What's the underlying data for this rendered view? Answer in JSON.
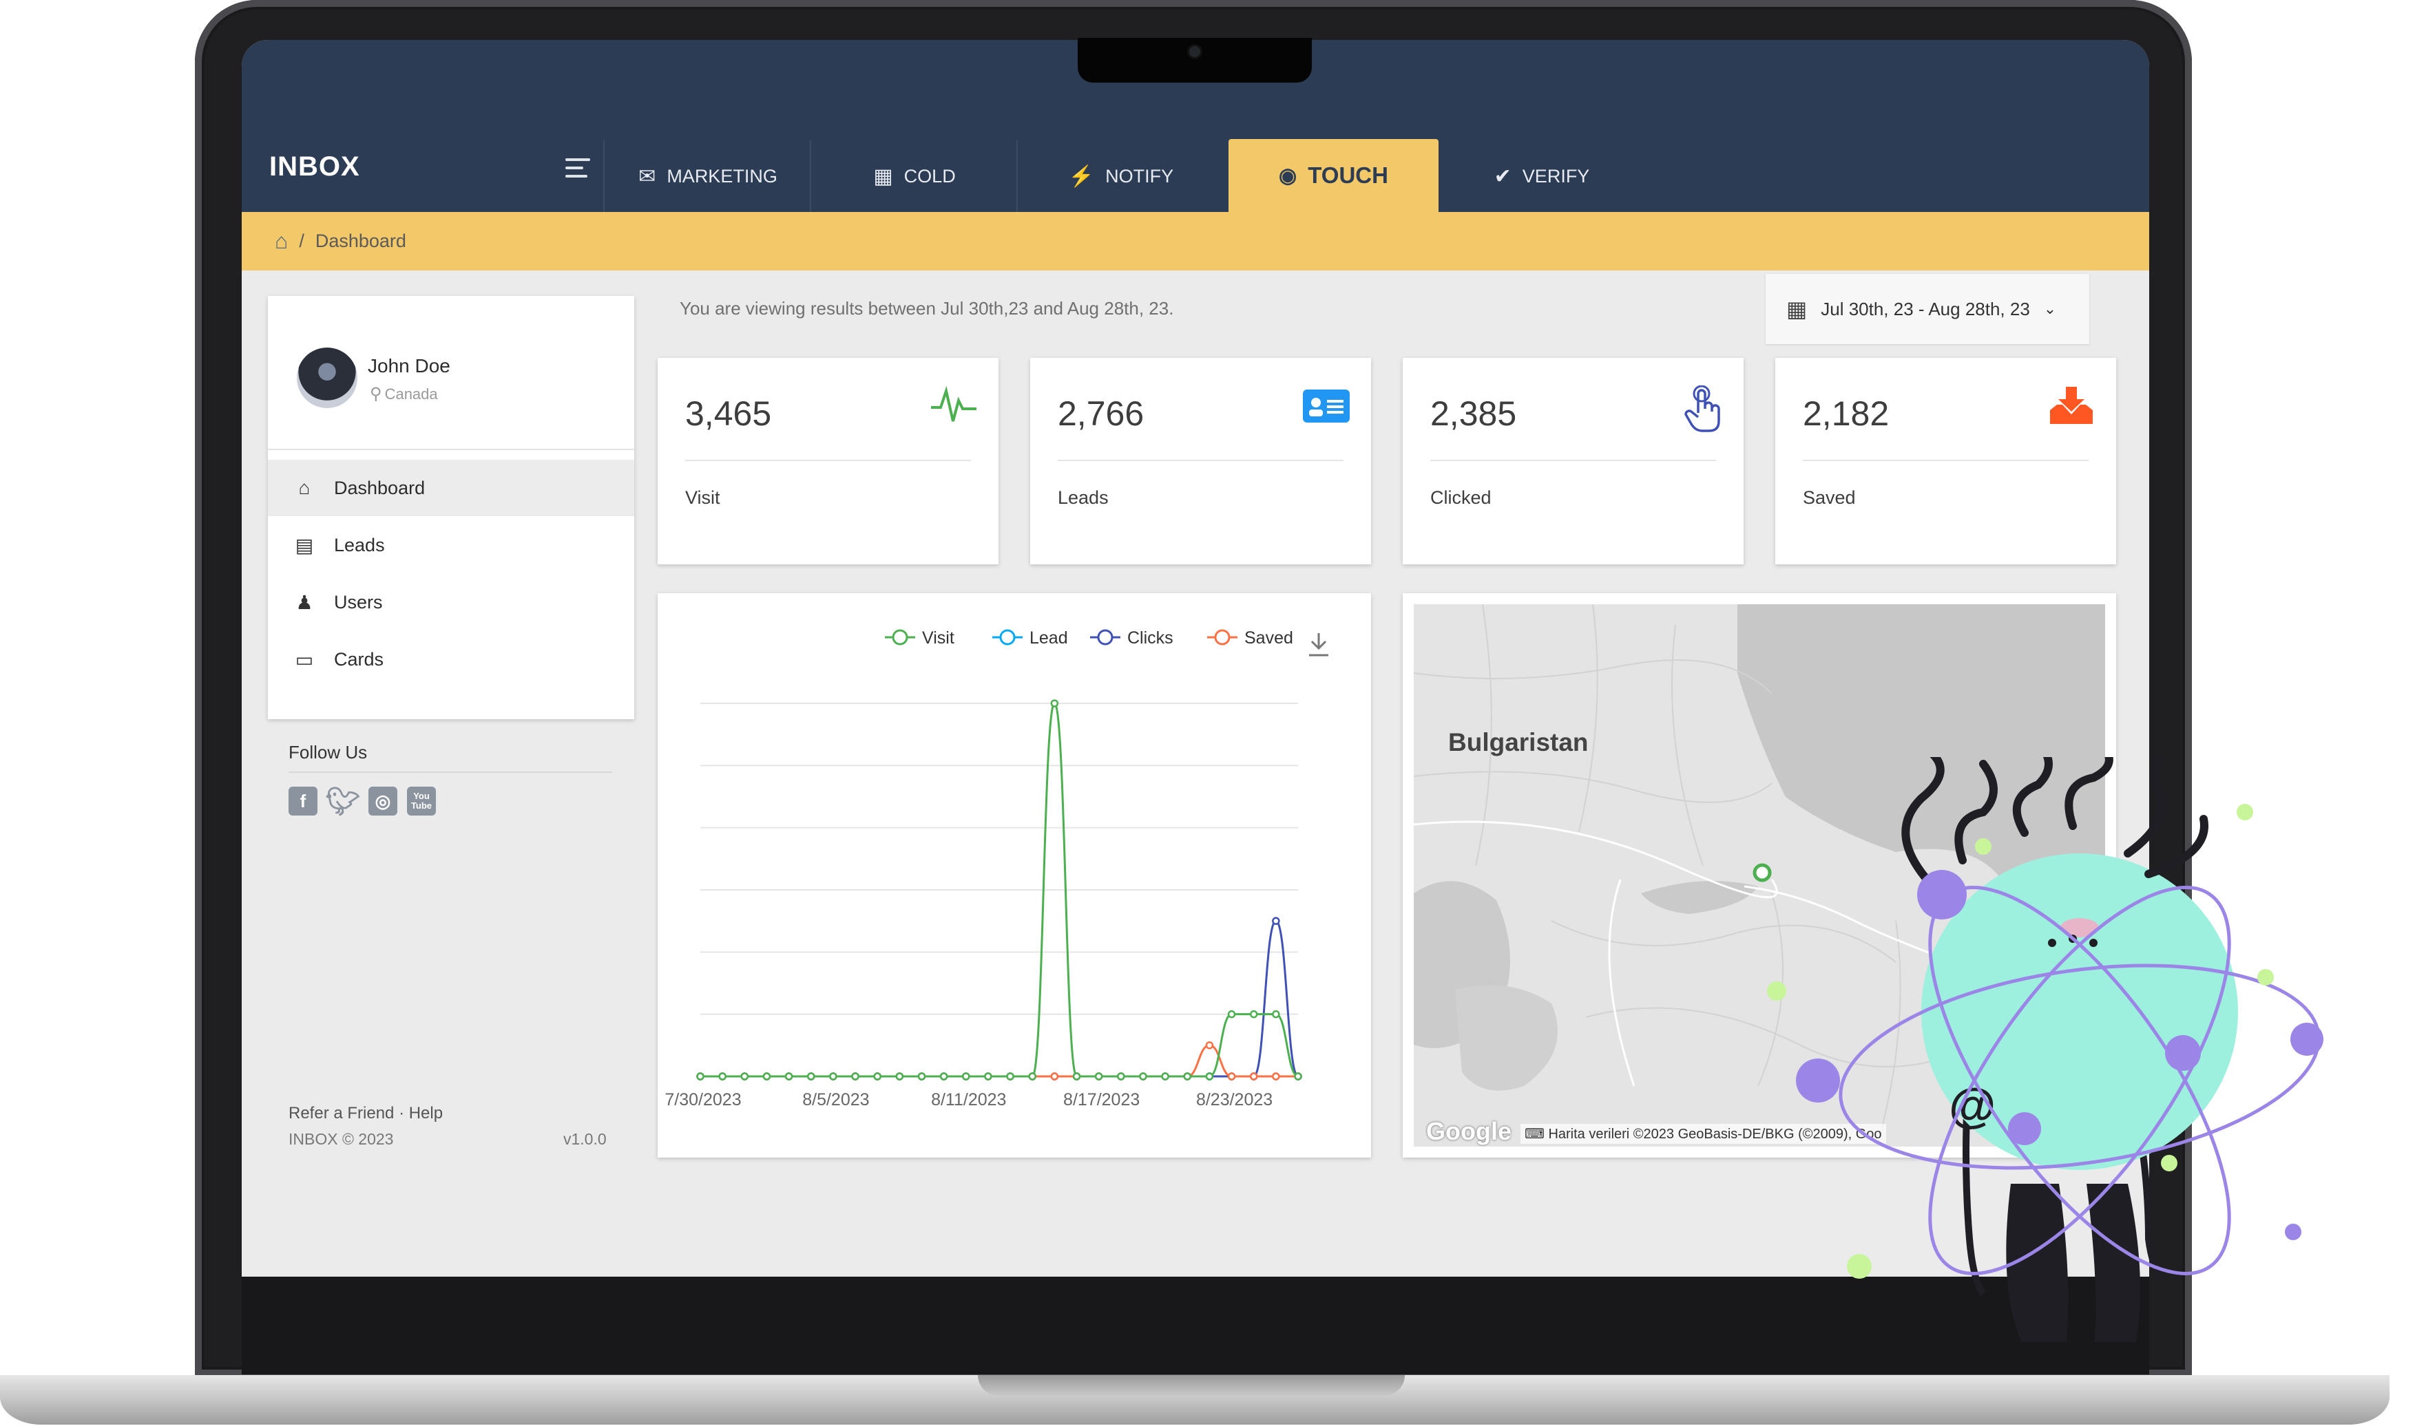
{
  "app": {
    "logo": "INBOX"
  },
  "nav": {
    "tabs": [
      {
        "label": "MARKETING",
        "icon": "envelope-icon"
      },
      {
        "label": "COLD",
        "icon": "calendar-grid-icon"
      },
      {
        "label": "NOTIFY",
        "icon": "lightning-icon"
      },
      {
        "label": "TOUCH",
        "icon": "fingerprint-icon",
        "active": true
      },
      {
        "label": "VERIFY",
        "icon": "checkmark-icon"
      }
    ]
  },
  "breadcrumb": {
    "current": "Dashboard"
  },
  "profile": {
    "name": "John Doe",
    "location": "Canada"
  },
  "sidebar": {
    "items": [
      {
        "label": "Dashboard",
        "icon": "home-icon",
        "active": true
      },
      {
        "label": "Leads",
        "icon": "id-card-icon"
      },
      {
        "label": "Users",
        "icon": "user-icon"
      },
      {
        "label": "Cards",
        "icon": "credit-card-icon"
      }
    ],
    "follow_title": "Follow Us",
    "social": [
      "facebook-icon",
      "twitter-icon",
      "instagram-icon",
      "youtube-icon"
    ]
  },
  "footer": {
    "links": "Refer a Friend · Help",
    "copyright": "INBOX © 2023",
    "version": "v1.0.0"
  },
  "main": {
    "range_text": "You are viewing results between Jul 30th,23 and Aug 28th, 23.",
    "date_range": "Jul 30th, 23 - Aug 28th, 23",
    "stats": [
      {
        "value": "3,465",
        "label": "Visit",
        "icon": "pulse-icon",
        "color": "#4caf50"
      },
      {
        "value": "2,766",
        "label": "Leads",
        "icon": "id-card-icon",
        "color": "#2196f3"
      },
      {
        "value": "2,385",
        "label": "Clicked",
        "icon": "touch-hand-icon",
        "color": "#3f51b5"
      },
      {
        "value": "2,182",
        "label": "Saved",
        "icon": "download-tray-icon",
        "color": "#ff5722"
      }
    ]
  },
  "map": {
    "label": "Bulgaristan",
    "attribution": "Harita verileri ©2023 GeoBasis-DE/BKG (©2009), Goo",
    "logo": "Google"
  },
  "chart_data": {
    "type": "line",
    "categories": [
      "7/30/2023",
      "7/31/2023",
      "8/1/2023",
      "8/2/2023",
      "8/3/2023",
      "8/4/2023",
      "8/5/2023",
      "8/6/2023",
      "8/7/2023",
      "8/8/2023",
      "8/9/2023",
      "8/10/2023",
      "8/11/2023",
      "8/12/2023",
      "8/13/2023",
      "8/14/2023",
      "8/15/2023",
      "8/16/2023",
      "8/17/2023",
      "8/18/2023",
      "8/19/2023",
      "8/20/2023",
      "8/21/2023",
      "8/22/2023",
      "8/23/2023",
      "8/24/2023",
      "8/25/2023",
      "8/26/2023"
    ],
    "tick_labels": [
      "7/30/2023",
      "8/5/2023",
      "8/11/2023",
      "8/17/2023",
      "8/23/2023"
    ],
    "series": [
      {
        "name": "Visit",
        "color": "#4caf50",
        "values": [
          0,
          0,
          0,
          0,
          0,
          0,
          0,
          0,
          0,
          0,
          0,
          0,
          0,
          0,
          0,
          0,
          3000,
          0,
          0,
          0,
          0,
          0,
          0,
          0,
          500,
          500,
          500,
          0
        ]
      },
      {
        "name": "Lead",
        "color": "#03a9f4",
        "values": [
          0,
          0,
          0,
          0,
          0,
          0,
          0,
          0,
          0,
          0,
          0,
          0,
          0,
          0,
          0,
          0,
          0,
          0,
          0,
          0,
          0,
          0,
          0,
          0,
          0,
          0,
          0,
          0
        ]
      },
      {
        "name": "Clicks",
        "color": "#3f51b5",
        "values": [
          0,
          0,
          0,
          0,
          0,
          0,
          0,
          0,
          0,
          0,
          0,
          0,
          0,
          0,
          0,
          0,
          0,
          0,
          0,
          0,
          0,
          0,
          0,
          0,
          0,
          0,
          1250,
          0
        ]
      },
      {
        "name": "Saved",
        "color": "#ff7043",
        "values": [
          0,
          0,
          0,
          0,
          0,
          0,
          0,
          0,
          0,
          0,
          0,
          0,
          0,
          0,
          0,
          0,
          0,
          0,
          0,
          0,
          0,
          0,
          0,
          250,
          0,
          0,
          0,
          0
        ]
      }
    ],
    "ylim": [
      0,
      3000
    ],
    "grid": true,
    "legend": "top",
    "download_icon": "download-icon"
  }
}
